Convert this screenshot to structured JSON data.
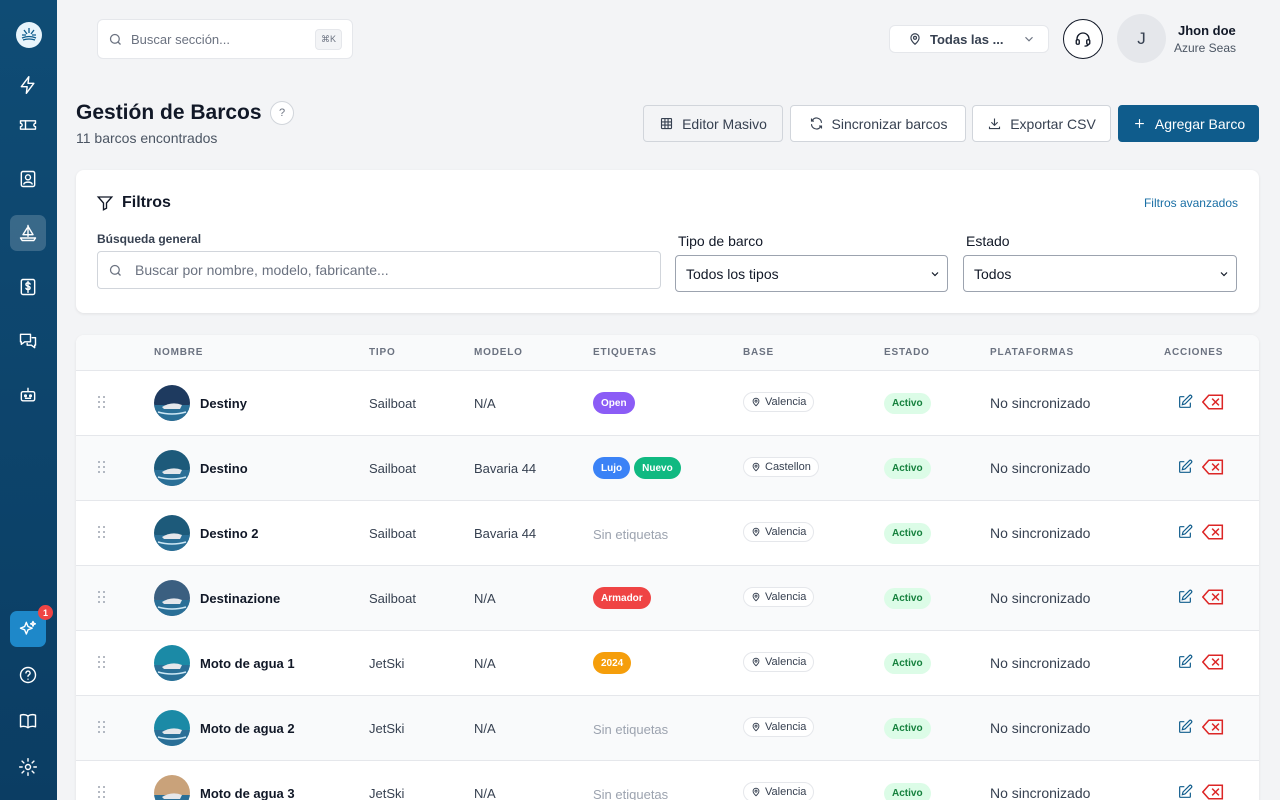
{
  "colors": {
    "sidebar": "#0f4c75",
    "primary": "#0f5c8c",
    "link": "#1a6fa5",
    "status_active_bg": "#dcfce7",
    "status_active_fg": "#15803d",
    "danger": "#dc2626"
  },
  "sidebar": {
    "items": [
      {
        "icon": "lightning-icon"
      },
      {
        "icon": "ticket-icon"
      },
      {
        "icon": "contacts-icon"
      },
      {
        "icon": "sailboat-icon",
        "active": true
      },
      {
        "icon": "dollar-icon"
      },
      {
        "icon": "chat-icon"
      },
      {
        "icon": "robot-icon"
      }
    ],
    "ai_badge": "1",
    "bottom": [
      {
        "icon": "help-icon"
      },
      {
        "icon": "book-icon"
      },
      {
        "icon": "gear-icon"
      }
    ]
  },
  "topbar": {
    "search_placeholder": "Buscar sección...",
    "shortcut": "⌘K",
    "location": "Todas las ...",
    "user": {
      "initial": "J",
      "name": "Jhon doe",
      "org": "Azure Seas"
    }
  },
  "header": {
    "title": "Gestión de Barcos",
    "help": "?",
    "subtitle": "11 barcos encontrados",
    "buttons": {
      "mass_edit": "Editor Masivo",
      "sync": "Sincronizar barcos",
      "export": "Exportar CSV",
      "add": "Agregar Barco"
    }
  },
  "filters": {
    "title": "Filtros",
    "advanced": "Filtros avanzados",
    "general_label": "Búsqueda general",
    "general_placeholder": "Buscar por nombre, modelo, fabricante...",
    "type_label": "Tipo de barco",
    "type_value": "Todos los tipos",
    "status_label": "Estado",
    "status_value": "Todos"
  },
  "table": {
    "columns": [
      "NOMBRE",
      "TIPO",
      "MODELO",
      "ETIQUETAS",
      "BASE",
      "ESTADO",
      "PLATAFORMAS",
      "ACCIONES"
    ],
    "no_tags": "Sin etiquetas",
    "rows": [
      {
        "name": "Destiny",
        "type": "Sailboat",
        "model": "N/A",
        "tags": [
          {
            "label": "Open",
            "color": "#8b5cf6"
          }
        ],
        "base": "Valencia",
        "status": "Activo",
        "platforms": "No sincronizado",
        "thumb": "#1e3a5f"
      },
      {
        "name": "Destino",
        "type": "Sailboat",
        "model": "Bavaria 44",
        "tags": [
          {
            "label": "Lujo",
            "color": "#3b82f6"
          },
          {
            "label": "Nuevo",
            "color": "#10b981"
          }
        ],
        "base": "Castellon",
        "status": "Activo",
        "platforms": "No sincronizado",
        "thumb": "#1d5a7a"
      },
      {
        "name": "Destino 2",
        "type": "Sailboat",
        "model": "Bavaria 44",
        "tags": [],
        "base": "Valencia",
        "status": "Activo",
        "platforms": "No sincronizado",
        "thumb": "#1d5a7a"
      },
      {
        "name": "Destinazione",
        "type": "Sailboat",
        "model": "N/A",
        "tags": [
          {
            "label": "Armador",
            "color": "#ef4444"
          }
        ],
        "base": "Valencia",
        "status": "Activo",
        "platforms": "No sincronizado",
        "thumb": "#3b5f80"
      },
      {
        "name": "Moto de agua 1",
        "type": "JetSki",
        "model": "N/A",
        "tags": [
          {
            "label": "2024",
            "color": "#f59e0b"
          }
        ],
        "base": "Valencia",
        "status": "Activo",
        "platforms": "No sincronizado",
        "thumb": "#1b8aa6"
      },
      {
        "name": "Moto de agua 2",
        "type": "JetSki",
        "model": "N/A",
        "tags": [],
        "base": "Valencia",
        "status": "Activo",
        "platforms": "No sincronizado",
        "thumb": "#1b8aa6"
      },
      {
        "name": "Moto de agua 3",
        "type": "JetSki",
        "model": "N/A",
        "tags": [],
        "base": "Valencia",
        "status": "Activo",
        "platforms": "No sincronizado",
        "thumb": "#c9a27a"
      }
    ]
  }
}
